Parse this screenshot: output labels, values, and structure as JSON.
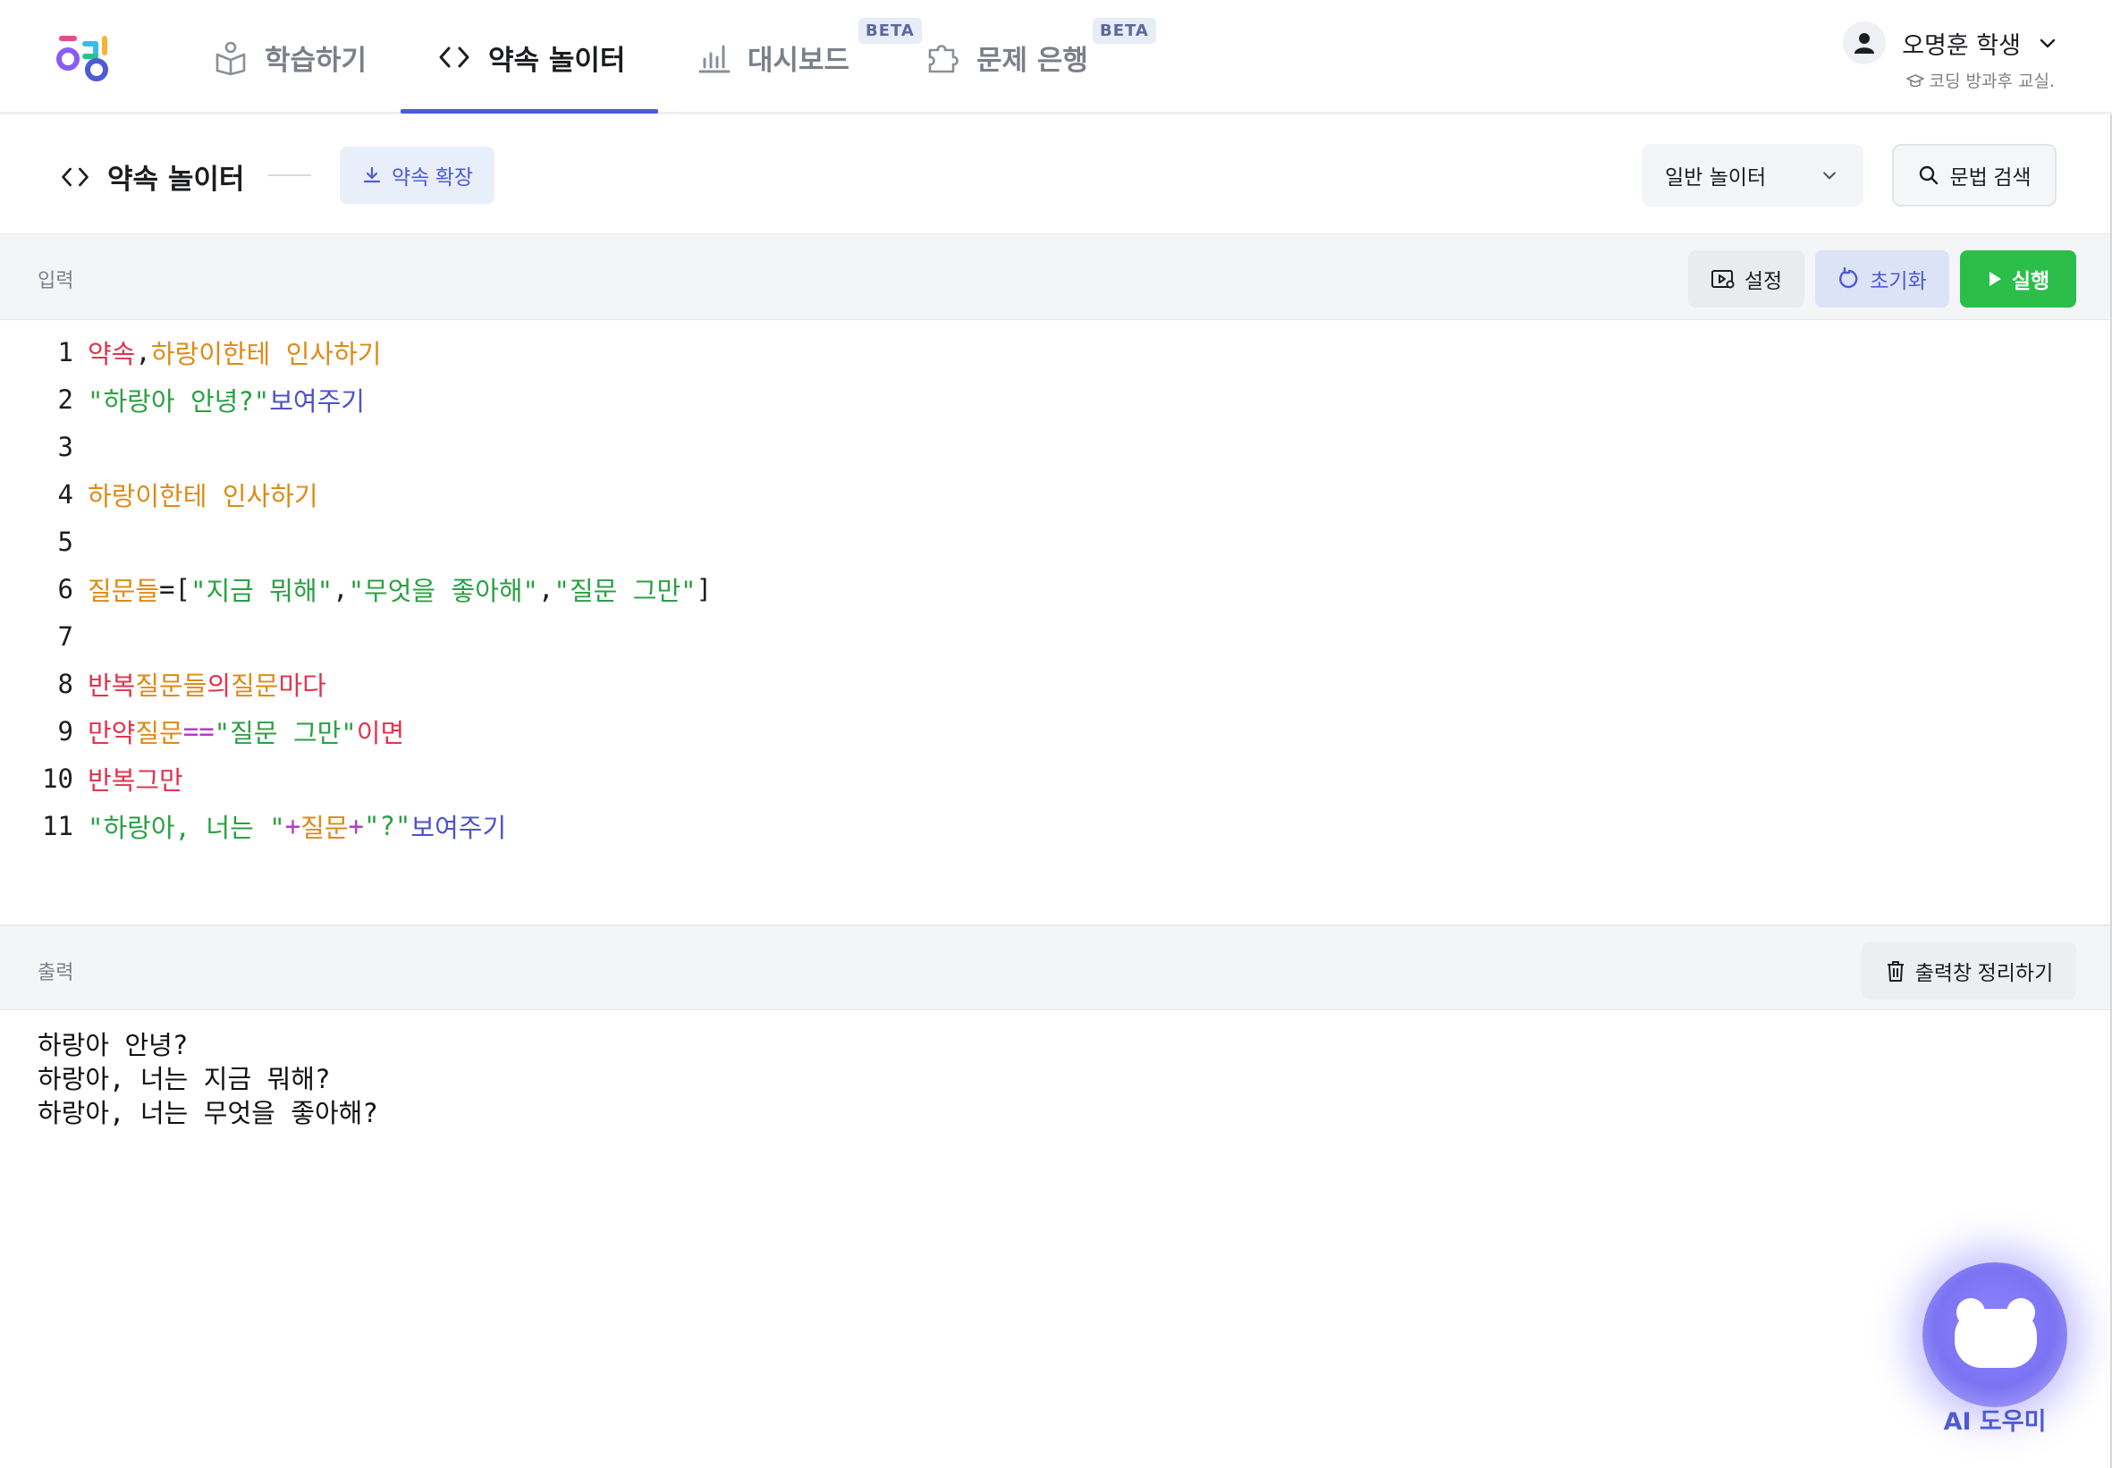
{
  "nav": {
    "items": [
      {
        "label": "학습하기",
        "icon": "book-icon"
      },
      {
        "label": "약속 놀이터",
        "icon": "code-icon",
        "active": true
      },
      {
        "label": "대시보드",
        "icon": "bar-chart-icon",
        "badge": "BETA"
      },
      {
        "label": "문제 은행",
        "icon": "puzzle-icon",
        "badge": "BETA"
      }
    ],
    "user": {
      "name": "오명훈 학생",
      "sub": "코딩 방과후 교실."
    },
    "accent": "#4d5bd6"
  },
  "subheader": {
    "title": "약속 놀이터",
    "extend_label": "약속 확장",
    "mode_select": "일반 놀이터",
    "search_label": "문법 검색"
  },
  "input_panel": {
    "label": "입력",
    "settings_label": "설정",
    "reset_label": "초기화",
    "run_label": "실행",
    "run_color": "#2bbf4a"
  },
  "code": {
    "line_numbers": [
      "1",
      "2",
      "3",
      "4",
      "5",
      "6",
      "7",
      "8",
      "9",
      "10",
      "11"
    ],
    "l1": {
      "kw": "약속",
      "comma": ",",
      "fn": "하랑이한테 인사하기"
    },
    "l2": {
      "str": "\"하랑아 안녕?\"",
      "out": "보여주기"
    },
    "l4": {
      "fn": "하랑이한테 인사하기"
    },
    "l6": {
      "var": "질문들",
      "eq": "=",
      "open": "[",
      "s1": "\"지금 뭐해\"",
      "c1": ",",
      "s2": "\"무엇을 좋아해\"",
      "c2": ",",
      "s3": "\"질문 그만\"",
      "close": "]"
    },
    "l8": {
      "kw1": "반복",
      "var": "질문들",
      "kw2": "의",
      "var2": "질문",
      "kw3": "마다"
    },
    "l9": {
      "kw1": "만약",
      "var": "질문",
      "op": "==",
      "str": "\"질문 그만\"",
      "kw2": "이면"
    },
    "l10": {
      "kw1": "반복",
      "kw2": "그만"
    },
    "l11": {
      "s1": "\"하랑아, 너는 \"",
      "op1": "+",
      "var": "질문",
      "op2": "+",
      "s2": "\"?\"",
      "out": "보여주기"
    }
  },
  "output_panel": {
    "label": "출력",
    "clear_label": "출력창 정리하기",
    "lines": [
      "하랑아 안녕?",
      "하랑아, 너는 지금 뭐해?",
      "하랑아, 너는 무엇을 좋아해?"
    ]
  },
  "ai_helper": {
    "label": "AI 도우미"
  }
}
